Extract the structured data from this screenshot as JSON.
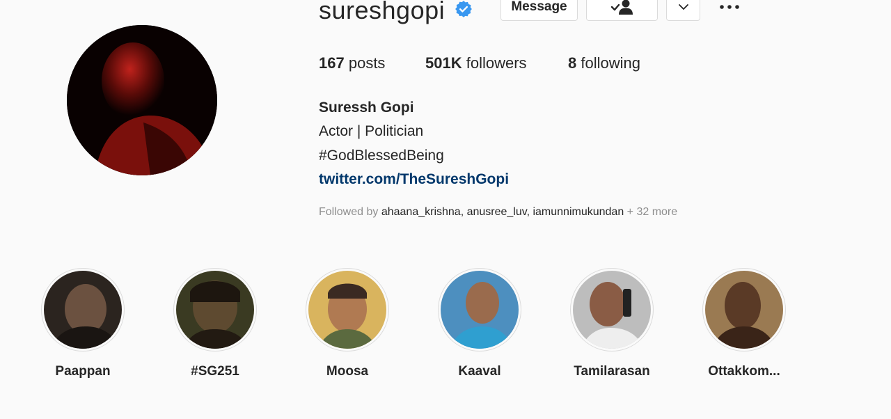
{
  "profile": {
    "username": "sureshgopi",
    "verified_icon": "verified-badge-icon",
    "full_name": "Suressh Gopi",
    "bio": [
      "Actor | Politician",
      "#GodBlessedBeing"
    ],
    "link": "twitter.com/TheSureshGopi"
  },
  "actions": {
    "message_label": "Message",
    "following_icon": "person-check-icon",
    "dropdown_icon": "chevron-down-icon",
    "more_icon": "ellipsis-icon"
  },
  "stats": {
    "posts_count": "167",
    "posts_label": "posts",
    "followers_count": "501K",
    "followers_label": "followers",
    "following_count": "8",
    "following_label": "following"
  },
  "followed_by": {
    "prefix": "Followed by",
    "names": "ahaana_krishna, anusree_luv, iamunnimukundan",
    "more": "+ 32 more"
  },
  "highlights": [
    {
      "label": "Paappan"
    },
    {
      "label": "#SG251"
    },
    {
      "label": "Moosa"
    },
    {
      "label": "Kaaval"
    },
    {
      "label": "Tamilarasan"
    },
    {
      "label": "Ottakkom..."
    }
  ],
  "colors": {
    "background": "#fafafa",
    "link": "#00376b",
    "verified": "#3897f0",
    "muted": "#8e8e8e"
  }
}
